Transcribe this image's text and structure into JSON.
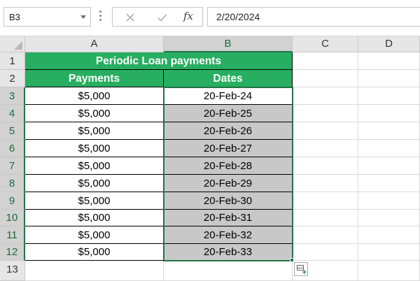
{
  "formula_bar": {
    "name_box": "B3",
    "fx_label": "fx",
    "formula_value": "2/20/2024"
  },
  "columns": [
    "A",
    "B",
    "C",
    "D"
  ],
  "rows": [
    "1",
    "2",
    "3",
    "4",
    "5",
    "6",
    "7",
    "8",
    "9",
    "10",
    "11",
    "12",
    "13"
  ],
  "sheet": {
    "title": "Periodic Loan payments",
    "headers": {
      "payments": "Payments",
      "dates": "Dates"
    },
    "records": [
      {
        "payment": "$5,000",
        "date": "20-Feb-24"
      },
      {
        "payment": "$5,000",
        "date": "20-Feb-25"
      },
      {
        "payment": "$5,000",
        "date": "20-Feb-26"
      },
      {
        "payment": "$5,000",
        "date": "20-Feb-27"
      },
      {
        "payment": "$5,000",
        "date": "20-Feb-28"
      },
      {
        "payment": "$5,000",
        "date": "20-Feb-29"
      },
      {
        "payment": "$5,000",
        "date": "20-Feb-30"
      },
      {
        "payment": "$5,000",
        "date": "20-Feb-31"
      },
      {
        "payment": "$5,000",
        "date": "20-Feb-32"
      },
      {
        "payment": "$5,000",
        "date": "20-Feb-33"
      }
    ]
  },
  "selection": {
    "active_cell": "B3",
    "range": "B3:B12"
  },
  "colors": {
    "header_fill": "#27ae60",
    "selection_border": "#217346",
    "selected_fill": "#c8c8c8"
  },
  "icons": {
    "cancel": "cancel-x-icon",
    "enter": "checkmark-icon",
    "quick_analysis": "quick-analysis-icon"
  }
}
